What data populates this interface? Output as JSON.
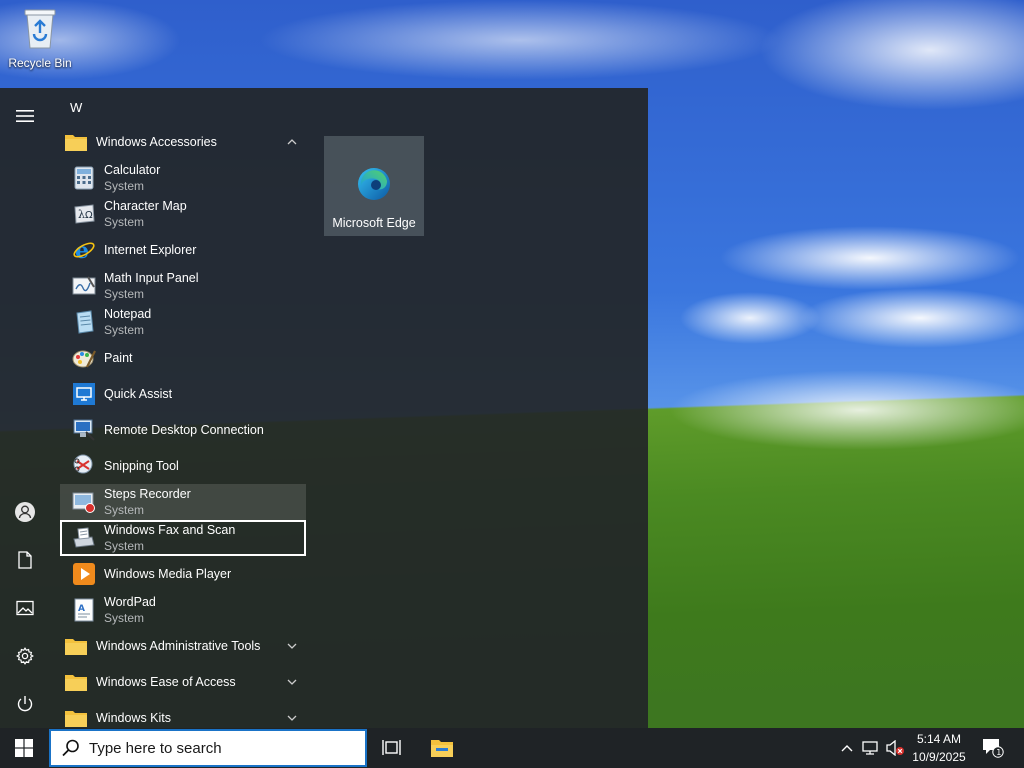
{
  "desktop": {
    "icons": [
      {
        "label": "Recycle Bin",
        "icon": "recycle-bin-icon"
      }
    ]
  },
  "start_menu": {
    "rail": [
      {
        "icon": "hamburger-menu-icon"
      },
      {
        "icon": "user-account-icon"
      },
      {
        "icon": "documents-icon"
      },
      {
        "icon": "pictures-icon"
      },
      {
        "icon": "settings-gear-icon"
      },
      {
        "icon": "power-icon"
      }
    ],
    "letter_header": "W",
    "windows_accessories": {
      "label": "Windows Accessories",
      "expanded": true,
      "items": [
        {
          "name": "Calculator",
          "sub": "System",
          "icon": "calculator-icon"
        },
        {
          "name": "Character Map",
          "sub": "System",
          "icon": "character-map-icon"
        },
        {
          "name": "Internet Explorer",
          "sub": "",
          "icon": "internet-explorer-icon"
        },
        {
          "name": "Math Input Panel",
          "sub": "System",
          "icon": "math-input-panel-icon"
        },
        {
          "name": "Notepad",
          "sub": "System",
          "icon": "notepad-icon"
        },
        {
          "name": "Paint",
          "sub": "",
          "icon": "paint-icon"
        },
        {
          "name": "Quick Assist",
          "sub": "",
          "icon": "quick-assist-icon"
        },
        {
          "name": "Remote Desktop Connection",
          "sub": "",
          "icon": "remote-desktop-icon"
        },
        {
          "name": "Snipping Tool",
          "sub": "",
          "icon": "snipping-tool-icon"
        },
        {
          "name": "Steps Recorder",
          "sub": "System",
          "icon": "steps-recorder-icon"
        },
        {
          "name": "Windows Fax and Scan",
          "sub": "System",
          "icon": "fax-and-scan-icon"
        },
        {
          "name": "Windows Media Player",
          "sub": "",
          "icon": "media-player-icon"
        },
        {
          "name": "WordPad",
          "sub": "System",
          "icon": "wordpad-icon"
        }
      ]
    },
    "folders": [
      {
        "label": "Windows Administrative Tools",
        "icon": "folder-icon"
      },
      {
        "label": "Windows Ease of Access",
        "icon": "folder-icon"
      },
      {
        "label": "Windows Kits",
        "icon": "folder-icon"
      }
    ],
    "tiles": [
      {
        "label": "Microsoft Edge",
        "icon": "edge-icon"
      }
    ]
  },
  "taskbar": {
    "search_placeholder": "Type here to search",
    "buttons": [
      {
        "icon": "windows-start-icon"
      },
      {
        "icon": "task-view-icon"
      },
      {
        "icon": "file-explorer-icon"
      }
    ],
    "tray": {
      "icons": [
        "chevron-up-icon",
        "network-icon",
        "volume-muted-icon"
      ],
      "time": "5:14 AM",
      "date": "10/9/2025",
      "notification_count": "1"
    }
  },
  "colors": {
    "menu_bg": "#222628",
    "taskbar_bg": "#1f2326",
    "accent": "#1a73c7",
    "folder_yellow": "#f3c13d"
  }
}
